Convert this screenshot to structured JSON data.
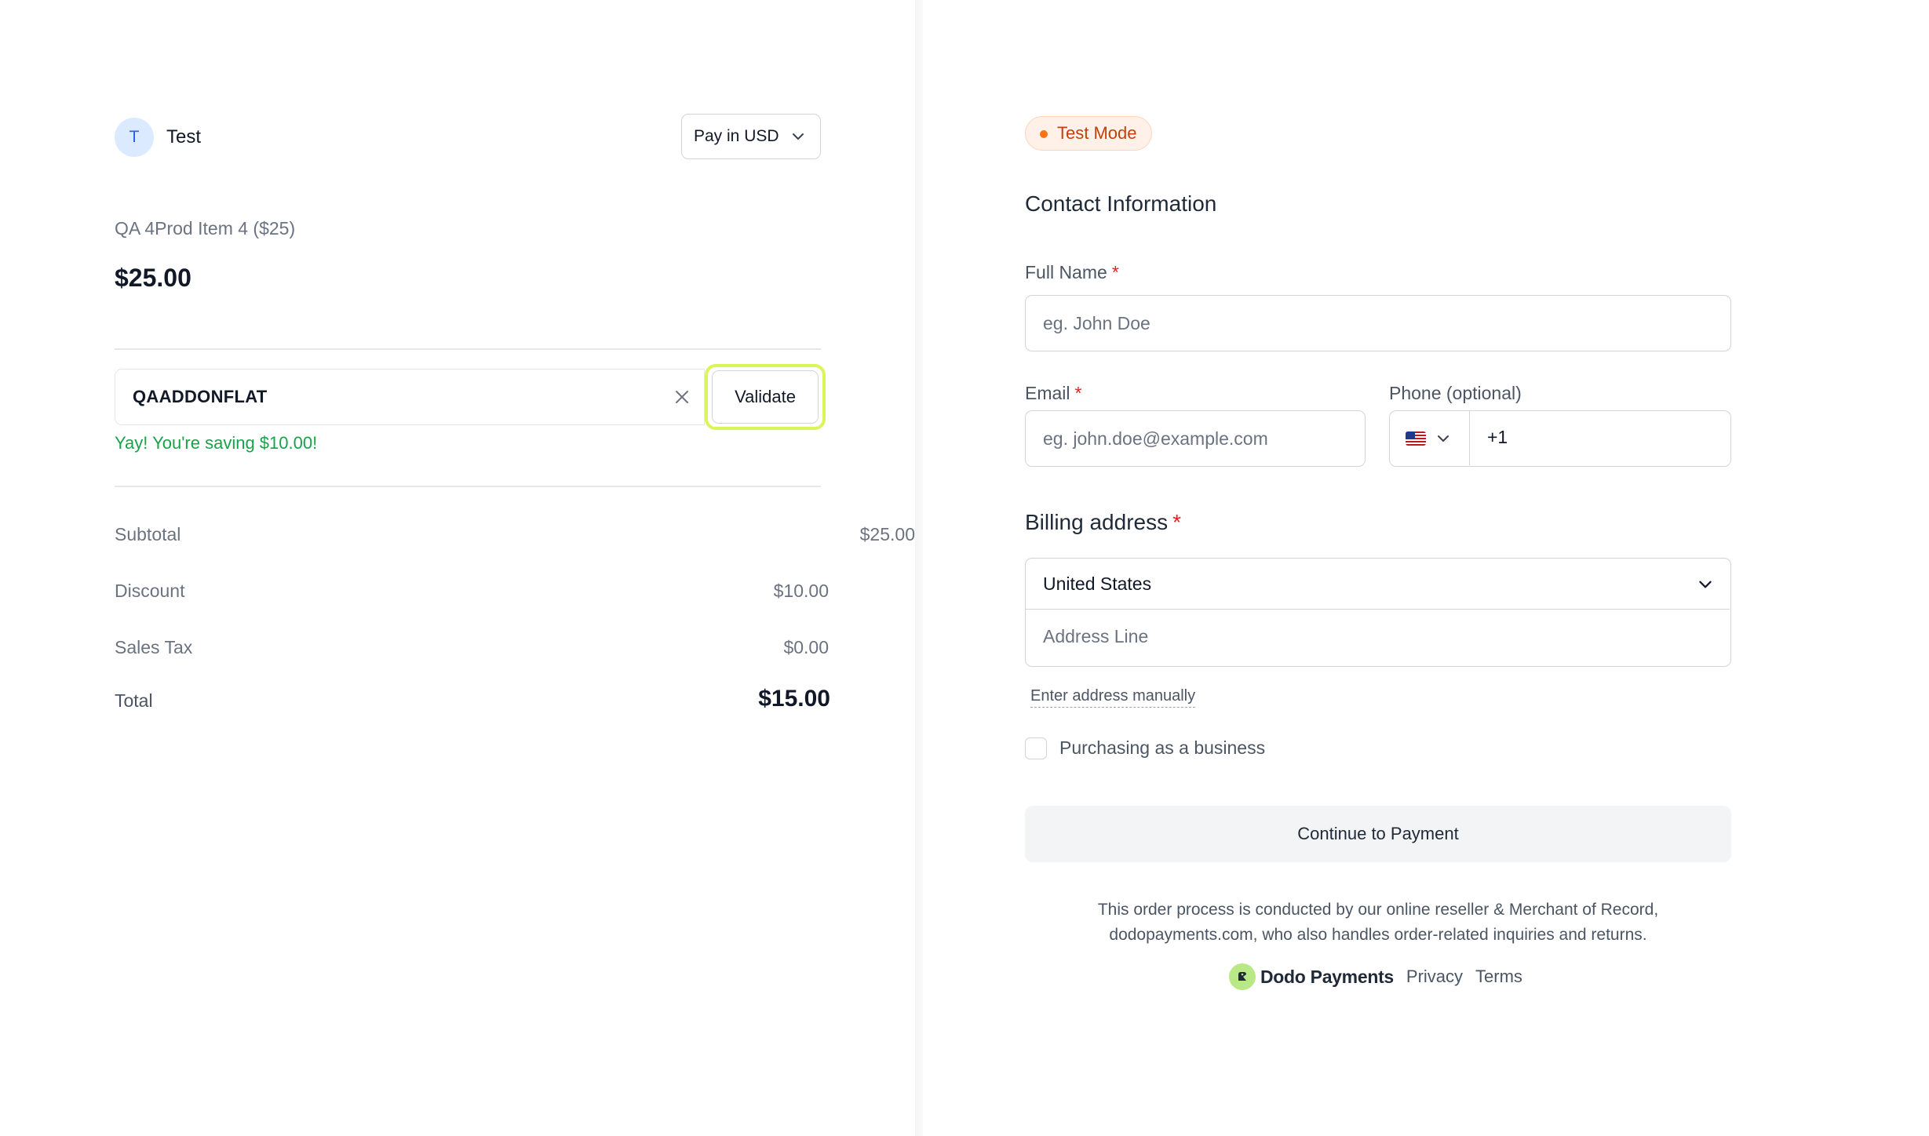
{
  "merchant": {
    "initial": "T",
    "name": "Test"
  },
  "currency": {
    "label": "Pay in USD"
  },
  "product": {
    "name": "QA 4Prod Item 4 ($25)",
    "price": "$25.00"
  },
  "coupon": {
    "value": "QAADDONFLAT",
    "validate_label": "Validate",
    "message": "Yay! You're saving $10.00!"
  },
  "summary": {
    "subtotal_label": "Subtotal",
    "subtotal_value": "$25.00",
    "discount_label": "Discount",
    "discount_value": "$10.00",
    "tax_label": "Sales Tax",
    "tax_value": "$0.00",
    "total_label": "Total",
    "total_value": "$15.00"
  },
  "badge": {
    "label": "Test Mode"
  },
  "contact": {
    "title": "Contact Information",
    "full_name_label": "Full Name",
    "full_name_placeholder": "eg. John Doe",
    "email_label": "Email",
    "email_placeholder": "eg. john.doe@example.com",
    "phone_label": "Phone (optional)",
    "phone_prefix": "+1",
    "required_mark": "*"
  },
  "billing": {
    "title": "Billing address",
    "country": "United States",
    "address_placeholder": "Address Line",
    "manual_link": "Enter address manually",
    "business_label": "Purchasing as a business"
  },
  "actions": {
    "continue_label": "Continue to Payment"
  },
  "footer": {
    "note_line1": "This order process is conducted by our online reseller & Merchant of Record,",
    "note_line2": "dodopayments.com, who also handles order-related inquiries and returns.",
    "brand": "Dodo Payments",
    "privacy": "Privacy",
    "terms": "Terms"
  },
  "colors": {
    "accent_highlight": "#d9f55b",
    "success": "#16a34a",
    "required": "#dc2626",
    "test_mode": "#c2410c"
  },
  "icons": {
    "currency_chevron": "chevron-down-icon",
    "coupon_clear": "close-icon",
    "phone_flag": "us-flag-icon",
    "country_chevron": "chevron-down-icon",
    "brand_logo": "dodo-logo-icon"
  }
}
